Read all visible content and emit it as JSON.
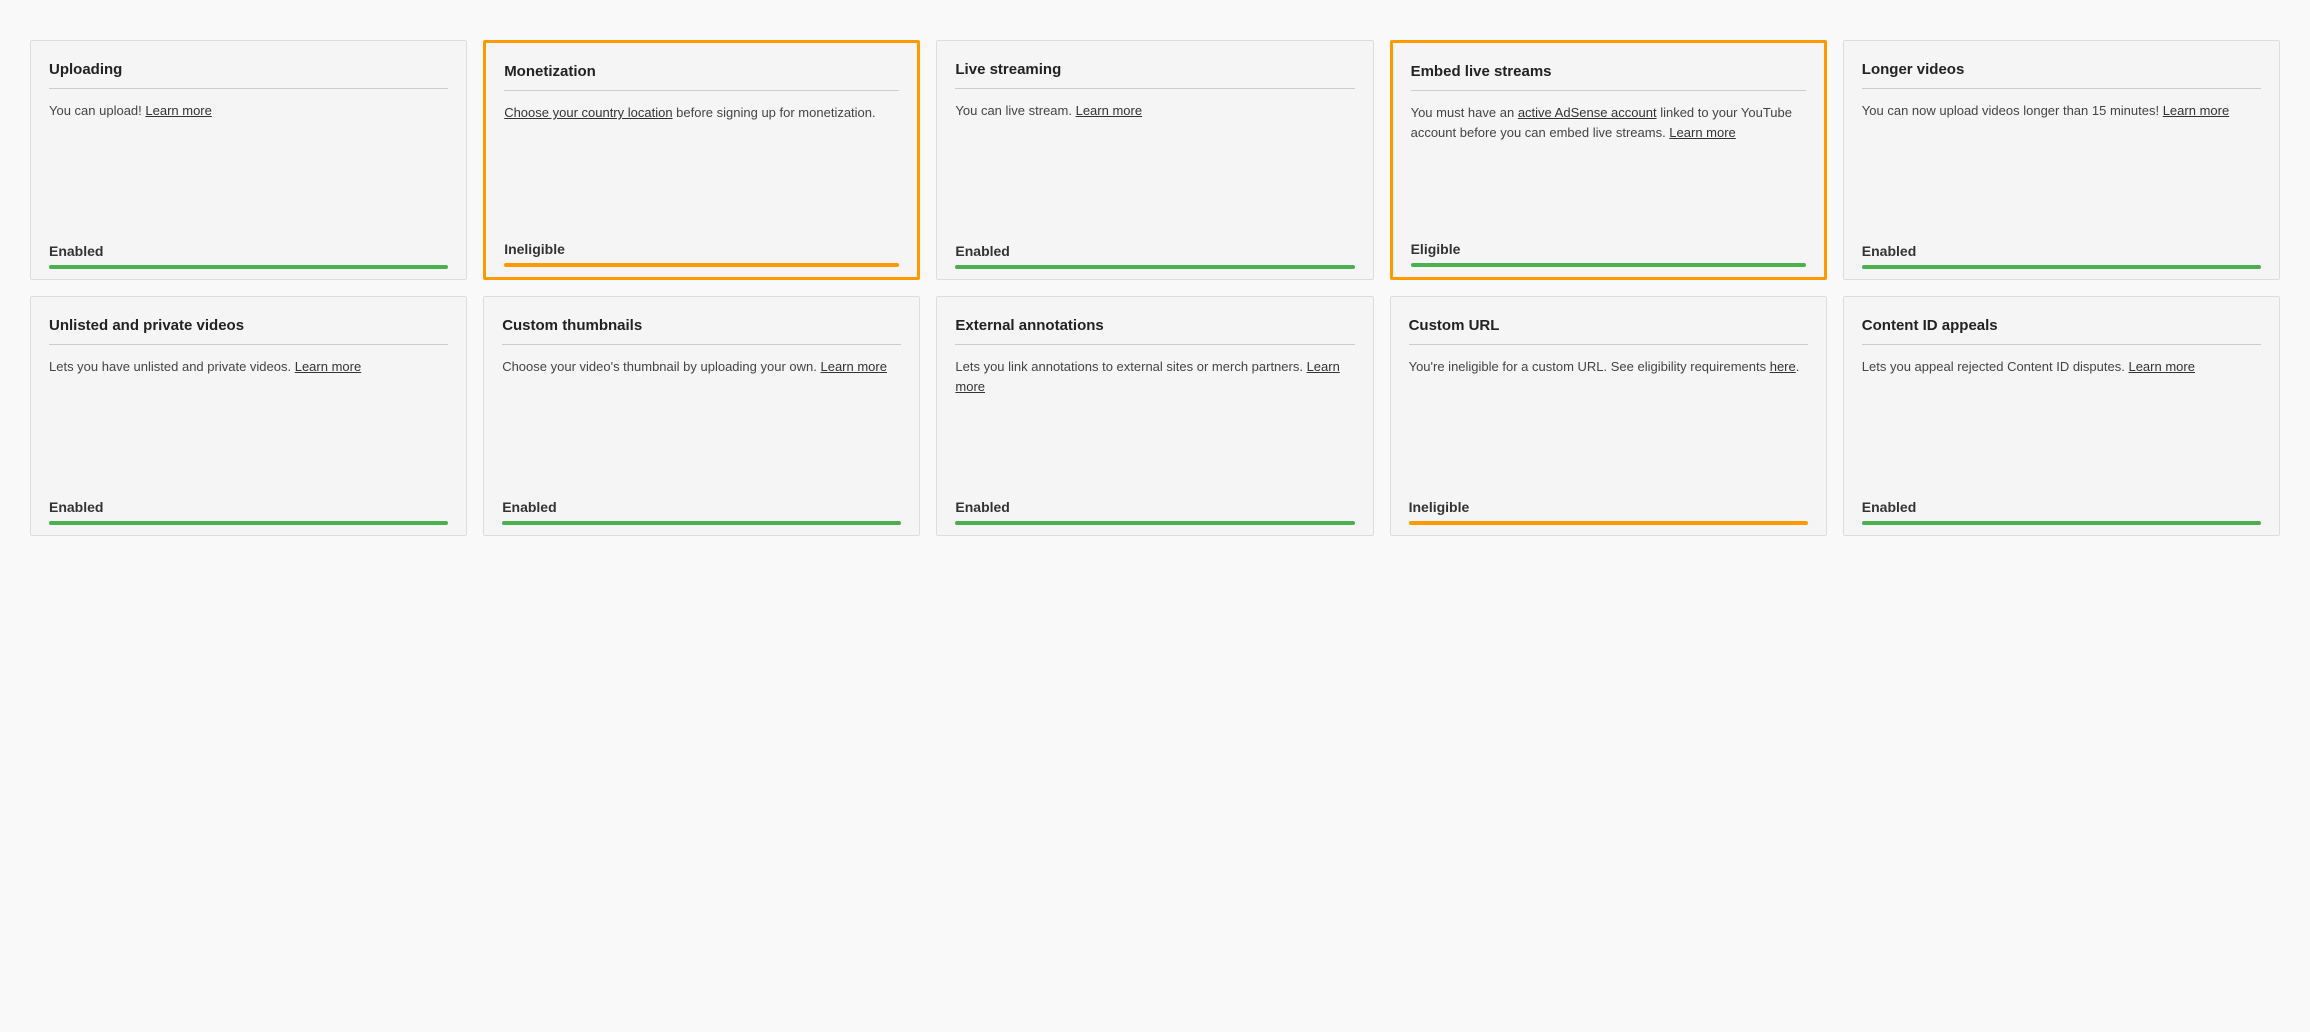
{
  "rows": [
    {
      "cards": [
        {
          "id": "uploading",
          "title": "Uploading",
          "description": "You can upload! ",
          "link_text": "Learn more",
          "link_href": "#",
          "status": "Enabled",
          "status_bar": "green",
          "highlighted": false
        },
        {
          "id": "monetization",
          "title": "Monetization",
          "description_parts": [
            {
              "text": "Choose your country location",
              "link": true
            },
            {
              "text": " before signing up for monetization.",
              "link": false
            }
          ],
          "status": "Ineligible",
          "status_bar": "orange",
          "highlighted": true
        },
        {
          "id": "live-streaming",
          "title": "Live streaming",
          "description": "You can live stream. ",
          "link_text": "Learn more",
          "link_href": "#",
          "status": "Enabled",
          "status_bar": "green",
          "highlighted": false
        },
        {
          "id": "embed-live-streams",
          "title": "Embed live streams",
          "description_parts": [
            {
              "text": "You must have an ",
              "link": false
            },
            {
              "text": "active AdSense account",
              "link": true
            },
            {
              "text": " linked to your YouTube account before you can embed live streams. ",
              "link": false
            },
            {
              "text": "Learn more",
              "link": true
            }
          ],
          "status": "Eligible",
          "status_bar": "green",
          "highlighted": true
        },
        {
          "id": "longer-videos",
          "title": "Longer videos",
          "description": "You can now upload videos longer than 15 minutes! ",
          "link_text": "Learn more",
          "link_href": "#",
          "status": "Enabled",
          "status_bar": "green",
          "highlighted": false
        }
      ]
    },
    {
      "cards": [
        {
          "id": "unlisted-private-videos",
          "title": "Unlisted and private videos",
          "description": "Lets you have unlisted and private videos. ",
          "link_text": "Learn more",
          "link_href": "#",
          "status": "Enabled",
          "status_bar": "green",
          "highlighted": false
        },
        {
          "id": "custom-thumbnails",
          "title": "Custom thumbnails",
          "description": "Choose your video's thumbnail by uploading your own. ",
          "link_text": "Learn more",
          "link_href": "#",
          "status": "Enabled",
          "status_bar": "green",
          "highlighted": false
        },
        {
          "id": "external-annotations",
          "title": "External annotations",
          "description": "Lets you link annotations to external sites or merch partners. ",
          "link_text": "Learn more",
          "link_href": "#",
          "status": "Enabled",
          "status_bar": "green",
          "highlighted": false
        },
        {
          "id": "custom-url",
          "title": "Custom URL",
          "description_parts": [
            {
              "text": "You're ineligible for a custom URL. See eligibility requirements ",
              "link": false
            },
            {
              "text": "here",
              "link": true
            },
            {
              "text": ".",
              "link": false
            }
          ],
          "status": "Ineligible",
          "status_bar": "orange",
          "highlighted": false
        },
        {
          "id": "content-id-appeals",
          "title": "Content ID appeals",
          "description": "Lets you appeal rejected Content ID disputes. ",
          "link_text": "Learn more",
          "link_href": "#",
          "status": "Enabled",
          "status_bar": "green",
          "highlighted": false
        }
      ]
    }
  ]
}
